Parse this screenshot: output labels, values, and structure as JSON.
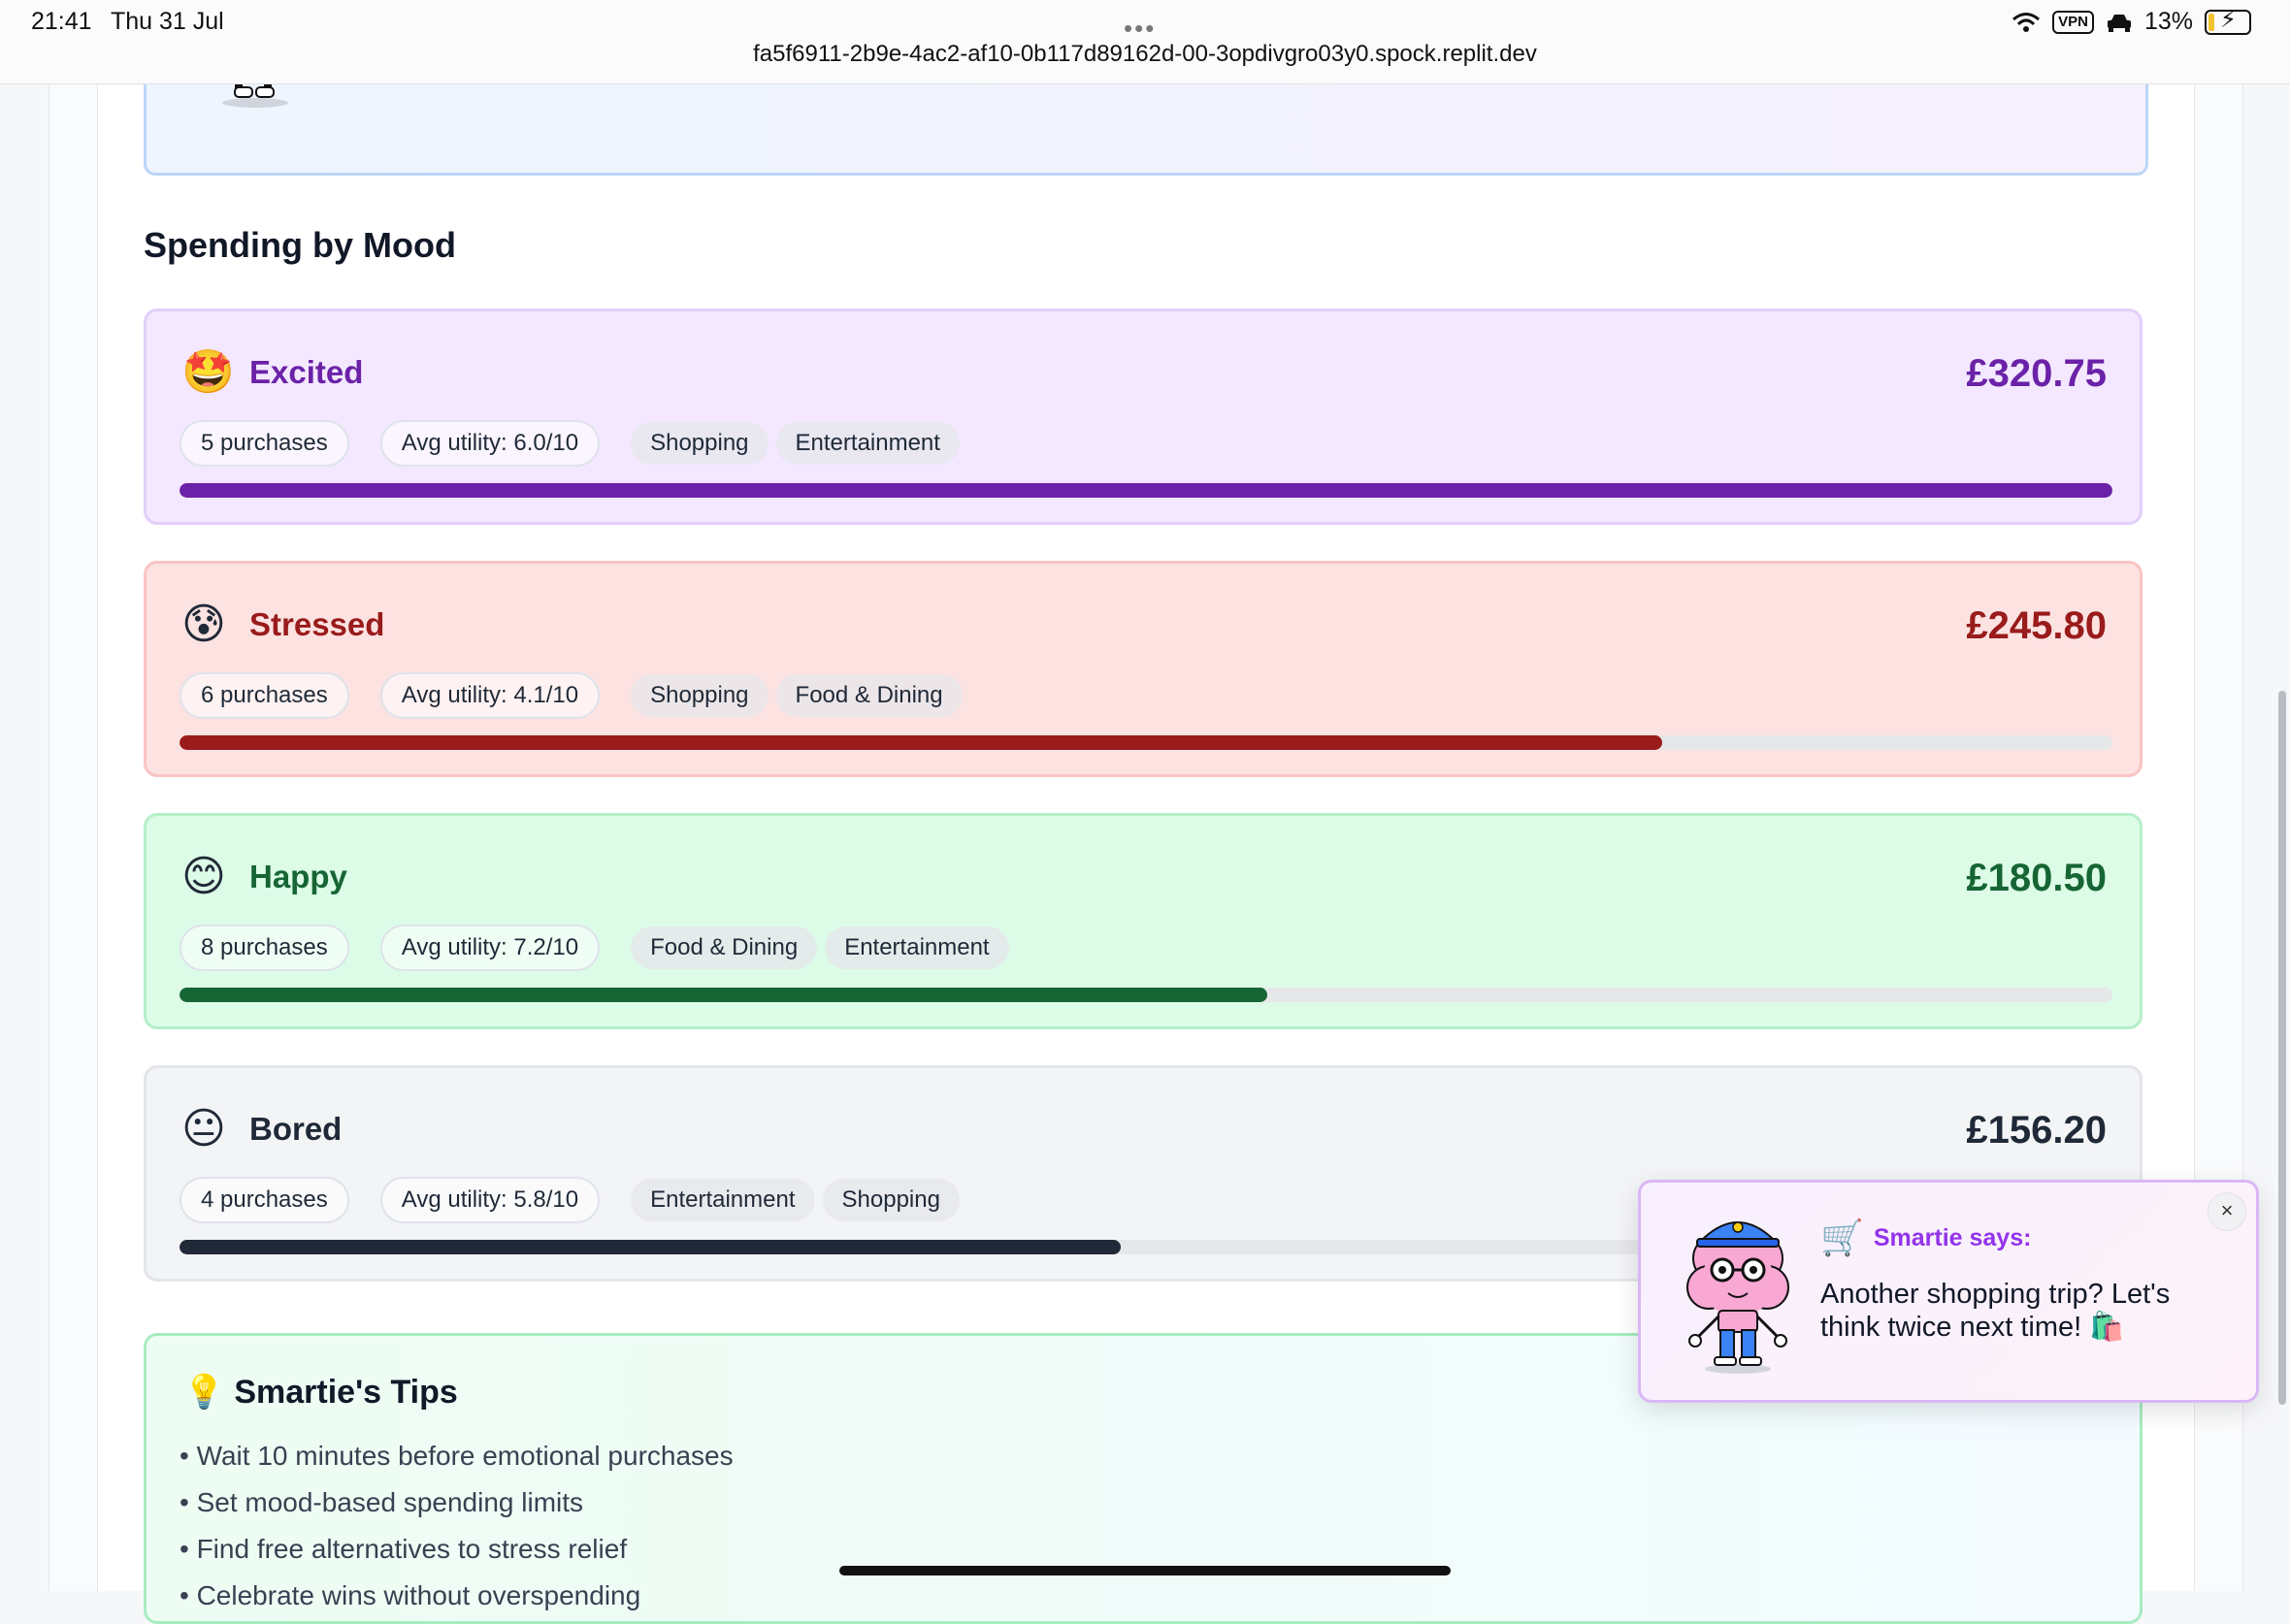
{
  "status_bar": {
    "time": "21:41",
    "date": "Thu 31 Jul",
    "url": "fa5f6911-2b9e-4ac2-af10-0b117d89162d-00-3opdivgro03y0.spock.replit.dev",
    "vpn_label": "VPN",
    "battery": "13%"
  },
  "section": {
    "title": "Spending by Mood"
  },
  "moods": [
    {
      "emoji": "🤩",
      "name": "Excited",
      "amount": "£320.75",
      "purchases": "5 purchases",
      "avg_utility": "Avg utility: 6.0/10",
      "categories": [
        "Shopping",
        "Entertainment"
      ],
      "bar_fraction": 1.0,
      "color": "#6b21a8",
      "bg": "#f3e8ff",
      "border": "#e2cff9"
    },
    {
      "emoji": "😰",
      "name": "Stressed",
      "amount": "£245.80",
      "purchases": "6 purchases",
      "avg_utility": "Avg utility: 4.1/10",
      "categories": [
        "Shopping",
        "Food & Dining"
      ],
      "bar_fraction": 0.767,
      "color": "#991b1b",
      "bg": "#fde2e2",
      "border": "#f9c4c4"
    },
    {
      "emoji": "😊",
      "name": "Happy",
      "amount": "£180.50",
      "purchases": "8 purchases",
      "avg_utility": "Avg utility: 7.2/10",
      "categories": [
        "Food & Dining",
        "Entertainment"
      ],
      "bar_fraction": 0.563,
      "color": "#166534",
      "bg": "#dcfce7",
      "border": "#b5efca"
    },
    {
      "emoji": "😐",
      "name": "Bored",
      "amount": "£156.20",
      "purchases": "4 purchases",
      "avg_utility": "Avg utility: 5.8/10",
      "categories": [
        "Entertainment",
        "Shopping"
      ],
      "bar_fraction": 0.487,
      "color": "#1f2937",
      "bg": "#f3f4f6",
      "border": "#e3e5e9"
    }
  ],
  "tips": {
    "icon": "lightbulb-icon",
    "emoji": "💡",
    "title": "Smartie's Tips",
    "items": [
      "• Wait 10 minutes before emotional purchases",
      "• Set mood-based spending limits",
      "• Find free alternatives to stress relief",
      "• Celebrate wins without overspending"
    ]
  },
  "popup": {
    "icon": "shopping-cart-icon",
    "cart_emoji": "🛒",
    "title": "Smartie says:",
    "message": "Another shopping trip? Let's think twice next time! 🛍️",
    "close_label": "×"
  }
}
